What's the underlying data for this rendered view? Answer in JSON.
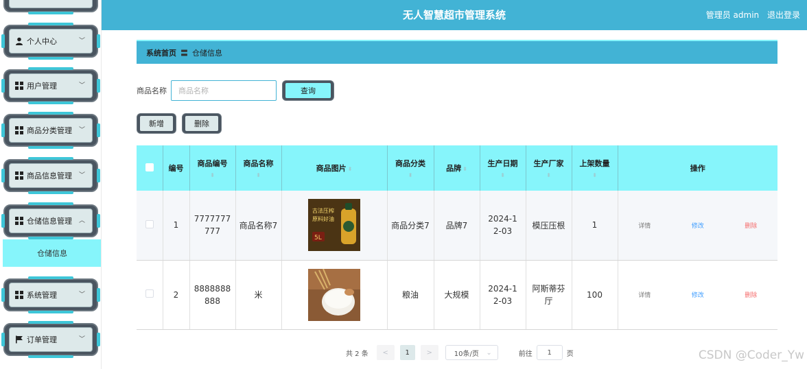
{
  "header": {
    "title": "无人智慧超市管理系统",
    "user": "管理员 admin",
    "logout": "退出登录"
  },
  "sidebar": {
    "items": [
      {
        "label": "个人中心",
        "icon": "user-icon",
        "chevron": "﹀"
      },
      {
        "label": "用户管理",
        "icon": "grid-icon",
        "chevron": "﹀"
      },
      {
        "label": "商品分类管理",
        "icon": "grid-icon",
        "chevron": "﹀"
      },
      {
        "label": "商品信息管理",
        "icon": "grid-icon",
        "chevron": "﹀"
      },
      {
        "label": "仓储信息管理",
        "icon": "grid-icon",
        "chevron": "︿"
      },
      {
        "label": "系统管理",
        "icon": "grid-icon",
        "chevron": "﹀"
      },
      {
        "label": "订单管理",
        "icon": "flag-icon",
        "chevron": "﹀"
      }
    ],
    "submenu_active": "仓储信息"
  },
  "breadcrumb": {
    "home": "系统首页",
    "separator": "〓",
    "current": "仓储信息"
  },
  "search": {
    "label": "商品名称",
    "placeholder": "商品名称",
    "value": "",
    "button": "查询"
  },
  "actions": {
    "add": "新增",
    "delete": "删除"
  },
  "table": {
    "columns": [
      "编号",
      "商品编号",
      "商品名称",
      "商品图片",
      "商品分类",
      "品牌",
      "生产日期",
      "生产厂家",
      "上架数量",
      "操作"
    ],
    "rows": [
      {
        "id": "1",
        "code": "7777777777",
        "name": "商品名称7",
        "image": "oil-bottle-image",
        "category": "商品分类7",
        "brand": "品牌7",
        "date": "2024-12-03",
        "maker": "模压压根",
        "qty": "1"
      },
      {
        "id": "2",
        "code": "8888888888",
        "name": "米",
        "image": "rice-bowl-image",
        "category": "粮油",
        "brand": "大规模",
        "date": "2024-12-03",
        "maker": "阿斯蒂芬厅",
        "qty": "100"
      }
    ],
    "ops": {
      "detail": "详情",
      "edit": "修改",
      "delete": "删除"
    },
    "image_text": {
      "line1": "古法压榨",
      "line2": "原料好油",
      "volume": "5L"
    }
  },
  "pagination": {
    "total": "共 2 条",
    "prev": "<",
    "current": "1",
    "next": ">",
    "page_size": "10条/页",
    "goto_label": "前往",
    "goto_value": "1",
    "page_suffix": "页"
  },
  "watermark": "CSDN @Coder_Yw",
  "colors": {
    "header": "#42b3d5",
    "accent_cyan": "#86f5fb",
    "edit": "#409eff",
    "delete": "#f56c6c"
  }
}
